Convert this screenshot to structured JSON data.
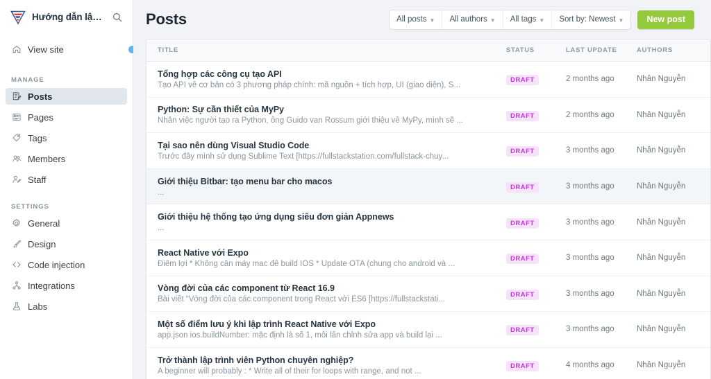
{
  "sidebar": {
    "brand": {
      "title": "Hướng dẫn lập trìn...",
      "logo_icon": "fullstack-logo-icon",
      "search_icon": "search-icon"
    },
    "view_site": {
      "label": "View site",
      "icon": "home-icon"
    },
    "groups": [
      {
        "title": "MANAGE",
        "items": [
          {
            "label": "Posts",
            "icon": "posts-icon",
            "active": true
          },
          {
            "label": "Pages",
            "icon": "pages-icon",
            "active": false
          },
          {
            "label": "Tags",
            "icon": "tag-icon",
            "active": false
          },
          {
            "label": "Members",
            "icon": "members-icon",
            "active": false
          },
          {
            "label": "Staff",
            "icon": "staff-icon",
            "active": false
          }
        ]
      },
      {
        "title": "SETTINGS",
        "items": [
          {
            "label": "General",
            "icon": "gear-icon",
            "active": false
          },
          {
            "label": "Design",
            "icon": "paintbrush-icon",
            "active": false
          },
          {
            "label": "Code injection",
            "icon": "code-brackets-icon",
            "active": false
          },
          {
            "label": "Integrations",
            "icon": "integrations-icon",
            "active": false
          },
          {
            "label": "Labs",
            "icon": "flask-icon",
            "active": false
          }
        ]
      }
    ],
    "notification_dot": "blue-status-dot"
  },
  "header": {
    "title": "Posts",
    "filters": [
      {
        "label": "All posts",
        "name": "filter-all-posts"
      },
      {
        "label": "All authors",
        "name": "filter-all-authors"
      },
      {
        "label": "All tags",
        "name": "filter-all-tags"
      },
      {
        "label": "Sort by: Newest",
        "name": "filter-sort-by"
      }
    ],
    "new_post_label": "New post"
  },
  "table": {
    "columns": {
      "title": "TITLE",
      "status": "STATUS",
      "last_update": "LAST UPDATE",
      "authors": "AUTHORS"
    },
    "rows": [
      {
        "title": "Tổng hợp các công cụ tạo API",
        "excerpt": "Tạo API về cơ bản có 3 phương pháp chính: mã nguồn + tích hợp, UI (giao diện), S...",
        "status": "DRAFT",
        "last_update": "2 months ago",
        "author": "Nhân Nguyễn",
        "highlighted": false
      },
      {
        "title": "Python: Sự cần thiết của MyPy",
        "excerpt": "Nhân việc người tạo ra Python, ông Guido van Rossum giới thiệu về MyPy, mình sẽ ...",
        "status": "DRAFT",
        "last_update": "2 months ago",
        "author": "Nhân Nguyễn",
        "highlighted": false
      },
      {
        "title": "Tại sao nên dùng Visual Studio Code",
        "excerpt": "Trước đây mình sử dụng Sublime Text [https://fullstackstation.com/fullstack-chuy...",
        "status": "DRAFT",
        "last_update": "3 months ago",
        "author": "Nhân Nguyễn",
        "highlighted": false
      },
      {
        "title": "Giới thiệu Bitbar: tạo menu bar cho macos",
        "excerpt": "...",
        "status": "DRAFT",
        "last_update": "3 months ago",
        "author": "Nhân Nguyễn",
        "highlighted": true
      },
      {
        "title": "Giới thiệu hệ thống tạo ứng dụng siêu đơn giản Appnews",
        "excerpt": "...",
        "status": "DRAFT",
        "last_update": "3 months ago",
        "author": "Nhân Nguyễn",
        "highlighted": false
      },
      {
        "title": "React Native với Expo",
        "excerpt": "Điểm lợi * Không cần máy mac để build IOS * Update OTA (chung cho android và ...",
        "status": "DRAFT",
        "last_update": "3 months ago",
        "author": "Nhân Nguyễn",
        "highlighted": false
      },
      {
        "title": "Vòng đời của các component từ React 16.9",
        "excerpt": "Bài viết “Vòng đời của các component trong React với ES6 [https://fullstackstati...",
        "status": "DRAFT",
        "last_update": "3 months ago",
        "author": "Nhân Nguyễn",
        "highlighted": false
      },
      {
        "title": "Một số điểm lưu ý khi lập trình React Native với Expo",
        "excerpt": "app.json ios.buildNumber: mặc định là số 1, mỗi lần chỉnh sửa app và build lại ...",
        "status": "DRAFT",
        "last_update": "3 months ago",
        "author": "Nhân Nguyễn",
        "highlighted": false
      },
      {
        "title": "Trở thành lập trình viên Python chuyên nghiệp?",
        "excerpt": "A beginner will probably : * Write all of their for loops with range, and not ...",
        "status": "DRAFT",
        "last_update": "4 months ago",
        "author": "Nhân Nguyễn",
        "highlighted": false
      }
    ]
  },
  "colors": {
    "accent_green": "#94c83d",
    "badge_bg": "#f6e2f9",
    "badge_text": "#c13ad6",
    "dot_blue": "#5ab8f0",
    "page_bg": "#f1f3f6"
  }
}
